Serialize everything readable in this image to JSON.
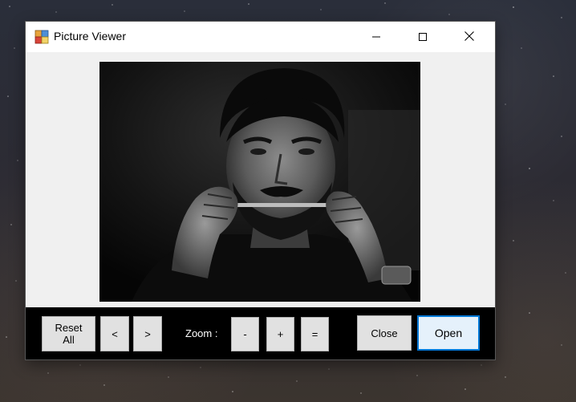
{
  "window": {
    "title": "Picture Viewer",
    "app_icon": "picture-viewer-app-icon",
    "controls": {
      "minimize_icon": "minimize-icon",
      "maximize_icon": "maximize-icon",
      "close_icon": "close-icon"
    }
  },
  "viewer": {
    "image": "portrait-photo"
  },
  "toolbar": {
    "reset_label": "Reset\nAll",
    "prev_label": "<",
    "next_label": ">",
    "zoom_label": "Zoom :",
    "zoom_out_label": "-",
    "zoom_in_label": "+",
    "zoom_reset_label": "=",
    "close_label": "Close",
    "open_label": "Open"
  },
  "colors": {
    "toolbar_background": "#000000",
    "client_background": "#f0f0f0",
    "focus_accent": "#0078d7"
  }
}
